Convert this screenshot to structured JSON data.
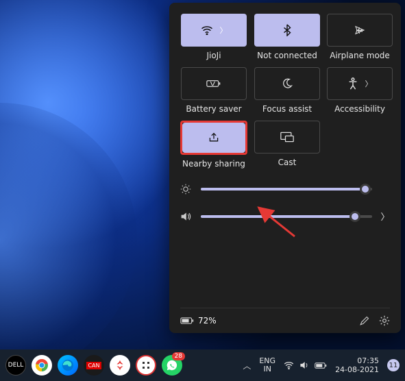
{
  "panel": {
    "tiles": [
      {
        "id": "wifi",
        "label": "JioJi",
        "active": true,
        "has_chevron": true
      },
      {
        "id": "bluetooth",
        "label": "Not connected",
        "active": true,
        "has_chevron": false
      },
      {
        "id": "airplane",
        "label": "Airplane mode",
        "active": false,
        "has_chevron": false
      },
      {
        "id": "battery-saver",
        "label": "Battery saver",
        "active": false,
        "has_chevron": false
      },
      {
        "id": "focus",
        "label": "Focus assist",
        "active": false,
        "has_chevron": false
      },
      {
        "id": "accessibility",
        "label": "Accessibility",
        "active": false,
        "has_chevron": true
      },
      {
        "id": "nearby",
        "label": "Nearby sharing",
        "active": true,
        "has_chevron": false,
        "highlighted": true
      },
      {
        "id": "cast",
        "label": "Cast",
        "active": false,
        "has_chevron": false
      }
    ],
    "sliders": {
      "brightness": 96,
      "volume": 90
    },
    "footer": {
      "battery_text": "72%"
    }
  },
  "taskbar": {
    "language": {
      "line1": "ENG",
      "line2": "IN"
    },
    "clock": {
      "time": "07:35",
      "date": "24-08-2021"
    },
    "notifications": "11",
    "whatsapp_badge": "28"
  }
}
